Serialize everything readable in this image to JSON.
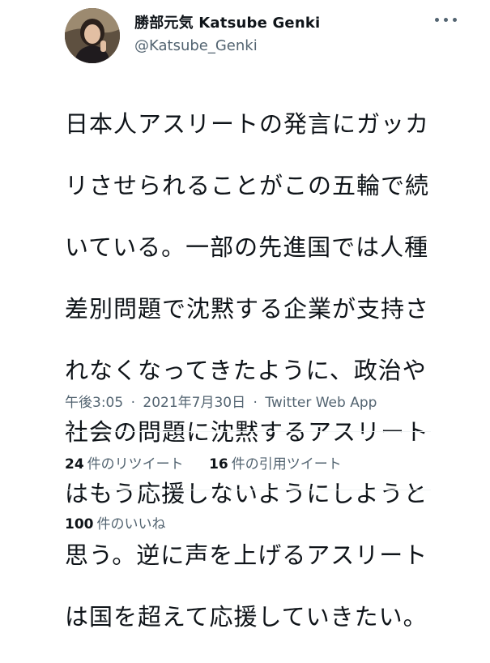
{
  "author": {
    "display_name": "勝部元気 Katsube Genki",
    "handle": "@Katsube_Genki",
    "avatar_icon": "profile-photo"
  },
  "more_icon": "more-horizontal-icon",
  "tweet": {
    "text": "日本人アスリートの発言にガッカリさせられることがこの五輪で続いている。一部の先進国では人種差別問題で沈黙する企業が支持されなくなってきたように、政治や社会の問題に沈黙するアスリートはもう応援しないようにしようと思う。逆に声を上げるアスリートは国を超えて応援していきたい。",
    "lines": [
      "日本人アスリートの発言にガッカ",
      "リさせられることがこの五輪で続",
      "いている。一部の先進国では人種",
      "差別問題で沈黙する企業が支持さ",
      "れなくなってきたように、政治や",
      "社会の問題に沈黙するアスリート",
      "はもう応援しないようにしようと",
      "思う。逆に声を上げるアスリート",
      "は国を超えて応援していきたい。"
    ]
  },
  "meta": {
    "time": "午後3:05",
    "separator": "·",
    "date": "2021年7月30日",
    "source": "Twitter Web App"
  },
  "stats": {
    "retweets_count": "24",
    "retweets_label": "件のリツイート",
    "quotes_count": "16",
    "quotes_label": "件の引用ツイート",
    "likes_count": "100",
    "likes_label": "件のいいね"
  },
  "colors": {
    "text_primary": "#0f1419",
    "text_secondary": "#536471",
    "divider": "#eff3f4"
  }
}
